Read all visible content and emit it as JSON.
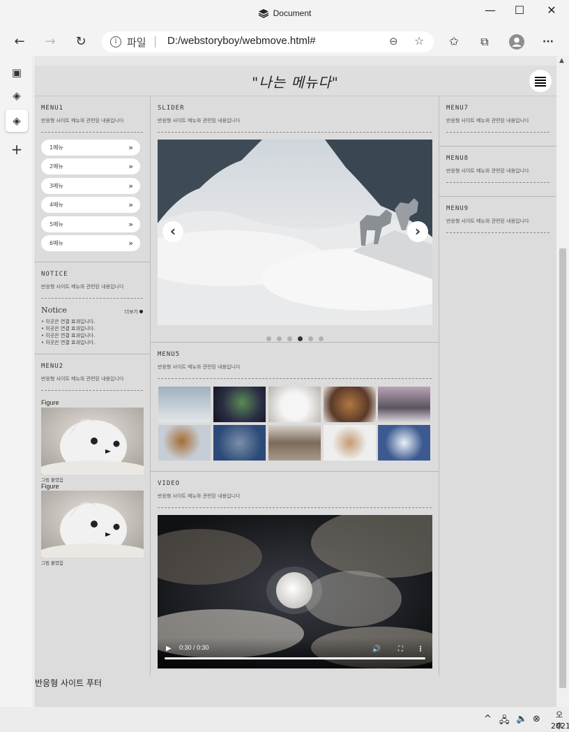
{
  "window": {
    "title": "Document",
    "minimize": "—",
    "maximize": "☐",
    "close": "✕"
  },
  "toolbar": {
    "back": "←",
    "forward": "→",
    "refresh": "↻",
    "protocol": "파일",
    "url": "D:/webstoryboy/webmove.html#",
    "zoom_icon": "⊖",
    "favorite_icon": "☆",
    "favorites": "✩",
    "collections": "⧉",
    "more": "···"
  },
  "sidebar": {
    "items": [
      "▣",
      "◈",
      "◈",
      "+"
    ]
  },
  "page": {
    "logo": "\"나는 메뉴다\"",
    "left": {
      "menu1": {
        "title": "MENU1",
        "desc": "반응형 사이트 메뉴와 관련된 내용입니다",
        "items": [
          "1메뉴",
          "2메뉴",
          "3메뉴",
          "4메뉴",
          "5메뉴",
          "6메뉴"
        ],
        "arrow": "»"
      },
      "notice": {
        "title": "NOTICE",
        "desc": "반응형 사이트 메뉴와 관련된 내용입니다",
        "head": "Notice",
        "more": "더보기",
        "items": [
          "이곳은 연결 효과입니다.",
          "이곳은 연결 효과입니다.",
          "이곳은 연결 효과입니다.",
          "이곳은 연결 효과입니다."
        ]
      },
      "menu2": {
        "title": "MENU2",
        "desc": "반응형 사이트 메뉴와 관련된 내용입니다",
        "fig1_title": "Figure",
        "fig1_caption": "그림 붙였음",
        "fig2_title": "Figure",
        "fig2_caption": "그림 붙였음"
      }
    },
    "center": {
      "slider": {
        "title": "SLIDER",
        "desc": "반응형 사이트 메뉴와 관련된 내용입니다",
        "prev": "‹",
        "next": "›",
        "dot_count": 6,
        "active_dot": 4
      },
      "menu5": {
        "title": "MENU5",
        "desc": "반응형 사이트 메뉴와 관련된 내용입니다"
      },
      "video": {
        "title": "VIDEO",
        "desc": "반응형 사이트 메뉴와 관련된 내용입니다",
        "time": "0:30 / 0:30",
        "play": "▶",
        "volume": "🔊",
        "fullscreen": "⛶",
        "more": "⋮"
      }
    },
    "right": {
      "sections": [
        {
          "title": "MENU7",
          "desc": "반응형 사이트 메뉴와 관련된 내용입니다"
        },
        {
          "title": "MENU8",
          "desc": "반응형 사이트 메뉴와 관련된 내용입니다"
        },
        {
          "title": "MENU9",
          "desc": "반응형 사이트 메뉴와 관련된 내용입니다"
        }
      ]
    },
    "footer": "반응형 사이트 푸터"
  },
  "taskbar": {
    "chevron": "^",
    "network": "🖧",
    "sound": "🔈",
    "close": "⊗",
    "time": "오후",
    "date": "2021"
  }
}
